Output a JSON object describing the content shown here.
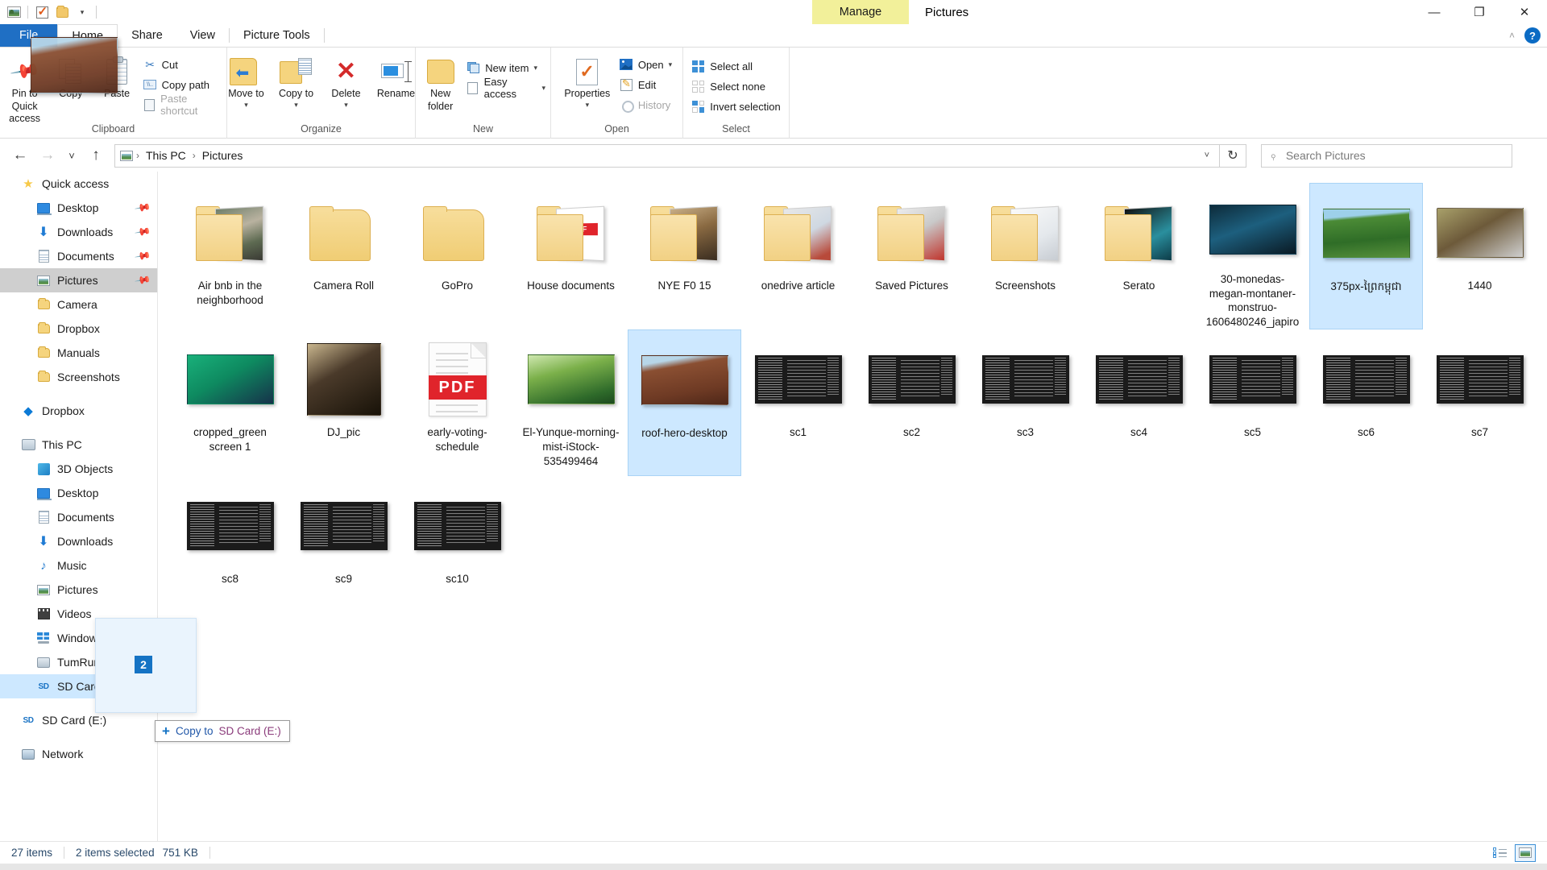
{
  "window": {
    "title": "Pictures",
    "contextual_tab_group": "Manage",
    "contextual_tab_label": "Picture Tools",
    "quick_access_icons": [
      "explorer-icon",
      "properties-check-icon",
      "new-folder-icon",
      "customize-qat-chevron"
    ],
    "controls": {
      "minimize": "—",
      "maximize": "❐",
      "close": "✕"
    },
    "ribbon_collapse": "˄",
    "help": "?"
  },
  "tabs": [
    {
      "label": "File",
      "state": "file"
    },
    {
      "label": "Home",
      "state": "active"
    },
    {
      "label": "Share",
      "state": "normal"
    },
    {
      "label": "View",
      "state": "normal"
    },
    {
      "label": "Picture Tools",
      "state": "contextual"
    }
  ],
  "ribbon": {
    "groups": [
      {
        "name": "Clipboard",
        "label": "Clipboard",
        "big_buttons": [
          {
            "label": "Pin to Quick access",
            "icon": "pin-icon"
          },
          {
            "label": "Copy",
            "icon": "copy-icon"
          },
          {
            "label": "Paste",
            "icon": "paste-icon"
          }
        ],
        "small_buttons": [
          {
            "label": "Cut",
            "icon": "scissors-icon",
            "disabled": false
          },
          {
            "label": "Copy path",
            "icon": "copy-path-icon",
            "disabled": false
          },
          {
            "label": "Paste shortcut",
            "icon": "paste-shortcut-icon",
            "disabled": true
          }
        ]
      },
      {
        "name": "Organize",
        "label": "Organize",
        "big_buttons": [
          {
            "label": "Move to",
            "icon": "move-to-icon",
            "dropdown": true
          },
          {
            "label": "Copy to",
            "icon": "copy-to-icon",
            "dropdown": true
          },
          {
            "label": "Delete",
            "icon": "delete-x-icon",
            "dropdown": true
          },
          {
            "label": "Rename",
            "icon": "rename-icon"
          }
        ]
      },
      {
        "name": "New",
        "label": "New",
        "big_buttons": [
          {
            "label": "New folder",
            "icon": "new-folder-icon"
          }
        ],
        "small_buttons": [
          {
            "label": "New item",
            "icon": "new-item-icon",
            "dropdown": true
          },
          {
            "label": "Easy access",
            "icon": "easy-access-icon",
            "dropdown": true
          }
        ]
      },
      {
        "name": "Open",
        "label": "Open",
        "big_buttons": [
          {
            "label": "Properties",
            "icon": "properties-icon",
            "dropdown": true
          }
        ],
        "small_buttons": [
          {
            "label": "Open",
            "icon": "open-picture-icon",
            "dropdown": true,
            "disabled": false
          },
          {
            "label": "Edit",
            "icon": "edit-pencil-icon",
            "disabled": false
          },
          {
            "label": "History",
            "icon": "history-clock-icon",
            "disabled": true
          }
        ]
      },
      {
        "name": "Select",
        "label": "Select",
        "small_buttons": [
          {
            "label": "Select all",
            "icon": "select-all-icon",
            "disabled": false
          },
          {
            "label": "Select none",
            "icon": "select-none-icon",
            "disabled": false
          },
          {
            "label": "Invert selection",
            "icon": "invert-selection-icon",
            "disabled": false
          }
        ]
      }
    ]
  },
  "address_bar": {
    "back": "←",
    "forward": "→",
    "recent": "˅",
    "up": "↑",
    "breadcrumb_icon": "pictures-icon",
    "breadcrumbs": [
      "This PC",
      "Pictures"
    ],
    "separator": "›",
    "dropdown": "˅",
    "refresh": "↻"
  },
  "search": {
    "icon": "search-icon",
    "placeholder": "Search Pictures",
    "value": ""
  },
  "nav_pane": {
    "items": [
      {
        "label": "Quick access",
        "icon": "star-icon",
        "level": 0,
        "pinned": false,
        "state": "normal"
      },
      {
        "label": "Desktop",
        "icon": "desktop-icon",
        "level": 1,
        "pinned": true,
        "state": "normal"
      },
      {
        "label": "Downloads",
        "icon": "download-icon",
        "level": 1,
        "pinned": true,
        "state": "normal"
      },
      {
        "label": "Documents",
        "icon": "document-icon",
        "level": 1,
        "pinned": true,
        "state": "normal"
      },
      {
        "label": "Pictures",
        "icon": "pictures-icon",
        "level": 1,
        "pinned": true,
        "state": "selected"
      },
      {
        "label": "Camera",
        "icon": "folder-icon",
        "level": 1,
        "pinned": false,
        "state": "normal"
      },
      {
        "label": "Dropbox",
        "icon": "dropbox-folder-icon",
        "level": 1,
        "pinned": false,
        "state": "normal"
      },
      {
        "label": "Manuals",
        "icon": "folder-icon",
        "level": 1,
        "pinned": false,
        "state": "normal"
      },
      {
        "label": "Screenshots",
        "icon": "folder-icon",
        "level": 1,
        "pinned": false,
        "state": "normal"
      },
      {
        "label": "__GAP__",
        "icon": "",
        "level": 0,
        "pinned": false,
        "state": "gap"
      },
      {
        "label": "Dropbox",
        "icon": "dropbox-icon",
        "level": 0,
        "pinned": false,
        "state": "normal"
      },
      {
        "label": "__GAP__",
        "icon": "",
        "level": 0,
        "pinned": false,
        "state": "gap"
      },
      {
        "label": "This PC",
        "icon": "this-pc-icon",
        "level": 0,
        "pinned": false,
        "state": "normal"
      },
      {
        "label": "3D Objects",
        "icon": "3d-objects-icon",
        "level": 1,
        "pinned": false,
        "state": "normal"
      },
      {
        "label": "Desktop",
        "icon": "desktop-icon",
        "level": 1,
        "pinned": false,
        "state": "normal"
      },
      {
        "label": "Documents",
        "icon": "document-icon",
        "level": 1,
        "pinned": false,
        "state": "normal"
      },
      {
        "label": "Downloads",
        "icon": "download-icon",
        "level": 1,
        "pinned": false,
        "state": "normal"
      },
      {
        "label": "Music",
        "icon": "music-icon",
        "level": 1,
        "pinned": false,
        "state": "normal"
      },
      {
        "label": "Pictures",
        "icon": "pictures-icon",
        "level": 1,
        "pinned": false,
        "state": "normal"
      },
      {
        "label": "Videos",
        "icon": "videos-icon",
        "level": 1,
        "pinned": false,
        "state": "normal"
      },
      {
        "label": "Windows (C:)",
        "icon": "windows-drive-icon",
        "level": 1,
        "pinned": false,
        "state": "normal"
      },
      {
        "label": "TumRum (D:)",
        "icon": "drive-icon",
        "level": 1,
        "pinned": false,
        "state": "normal"
      },
      {
        "label": "SD Card (E:)",
        "icon": "sd-card-icon",
        "level": 1,
        "pinned": false,
        "state": "droptarget"
      },
      {
        "label": "__GAP__",
        "icon": "",
        "level": 0,
        "pinned": false,
        "state": "gap"
      },
      {
        "label": "SD Card (E:)",
        "icon": "sd-card-icon",
        "level": 0,
        "pinned": false,
        "state": "normal"
      },
      {
        "label": "__GAP__",
        "icon": "",
        "level": 0,
        "pinned": false,
        "state": "gap"
      },
      {
        "label": "Network",
        "icon": "network-icon",
        "level": 0,
        "pinned": false,
        "state": "normal"
      }
    ]
  },
  "file_grid": {
    "items": [
      {
        "name": "Air bnb in the neighborhood",
        "kind": "folder-with-preview",
        "thumb": "ph-airbnb",
        "selected": false
      },
      {
        "name": "Camera Roll",
        "kind": "folder",
        "thumb": "",
        "selected": false
      },
      {
        "name": "GoPro",
        "kind": "folder",
        "thumb": "",
        "selected": false
      },
      {
        "name": "House documents",
        "kind": "folder-with-preview",
        "thumb": "pdf",
        "selected": false
      },
      {
        "name": "NYE F0 15",
        "kind": "folder-with-preview",
        "thumb": "ph-nye",
        "selected": false
      },
      {
        "name": "onedrive article",
        "kind": "folder-with-preview",
        "thumb": "ph-onedrive",
        "selected": false
      },
      {
        "name": "Saved Pictures",
        "kind": "folder-with-preview",
        "thumb": "ph-saved",
        "selected": false
      },
      {
        "name": "Screenshots",
        "kind": "folder-with-preview",
        "thumb": "ph-screens",
        "selected": false
      },
      {
        "name": "Serato",
        "kind": "folder-with-preview",
        "thumb": "ph-serato",
        "selected": false
      },
      {
        "name": "30-monedas-megan-montaner-monstruo-1606480246_japiro",
        "kind": "image",
        "thumb": "ph-monedas",
        "selected": false
      },
      {
        "name": "375px-ព្រៃកម្ពុជា",
        "kind": "image",
        "thumb": "ph-forest",
        "selected": true
      },
      {
        "name": "1440",
        "kind": "image",
        "thumb": "ph-bear",
        "selected": false
      },
      {
        "name": "cropped_green screen 1",
        "kind": "image",
        "thumb": "ph-green",
        "selected": false
      },
      {
        "name": "DJ_pic",
        "kind": "image-portrait",
        "thumb": "ph-dj",
        "selected": false
      },
      {
        "name": "early-voting-schedule",
        "kind": "pdf",
        "thumb": "pdf",
        "selected": false
      },
      {
        "name": "El-Yunque-morning-mist-iStock-535499464",
        "kind": "image",
        "thumb": "ph-elyunque",
        "selected": false
      },
      {
        "name": "roof-hero-desktop",
        "kind": "image",
        "thumb": "ph-roof",
        "selected": true
      },
      {
        "name": "sc1",
        "kind": "terminal",
        "thumb": "term",
        "selected": false
      },
      {
        "name": "sc2",
        "kind": "terminal",
        "thumb": "term",
        "selected": false
      },
      {
        "name": "sc3",
        "kind": "terminal",
        "thumb": "term",
        "selected": false
      },
      {
        "name": "sc4",
        "kind": "terminal",
        "thumb": "term",
        "selected": false
      },
      {
        "name": "sc5",
        "kind": "terminal",
        "thumb": "term",
        "selected": false
      },
      {
        "name": "sc6",
        "kind": "terminal",
        "thumb": "term",
        "selected": false
      },
      {
        "name": "sc7",
        "kind": "terminal",
        "thumb": "term",
        "selected": false
      },
      {
        "name": "sc8",
        "kind": "terminal",
        "thumb": "term",
        "selected": false
      },
      {
        "name": "sc9",
        "kind": "terminal",
        "thumb": "term",
        "selected": false
      },
      {
        "name": "sc10",
        "kind": "terminal",
        "thumb": "term",
        "selected": false
      }
    ]
  },
  "drag": {
    "badge_count": "2",
    "tooltip_plus": "+",
    "tooltip_action": "Copy to ",
    "tooltip_target": "SD Card (E:)"
  },
  "status_bar": {
    "item_count": "27 items",
    "selection": "2 items selected",
    "size": "751 KB",
    "view_details_icon": "details-view-icon",
    "view_large_icon": "large-icons-view-icon"
  },
  "colors": {
    "accent": "#1f6fc4",
    "selection": "#cde8ff",
    "contextual_tab": "#f2f09a",
    "folder": "#f5d47e",
    "pdf_red": "#e0242b"
  }
}
